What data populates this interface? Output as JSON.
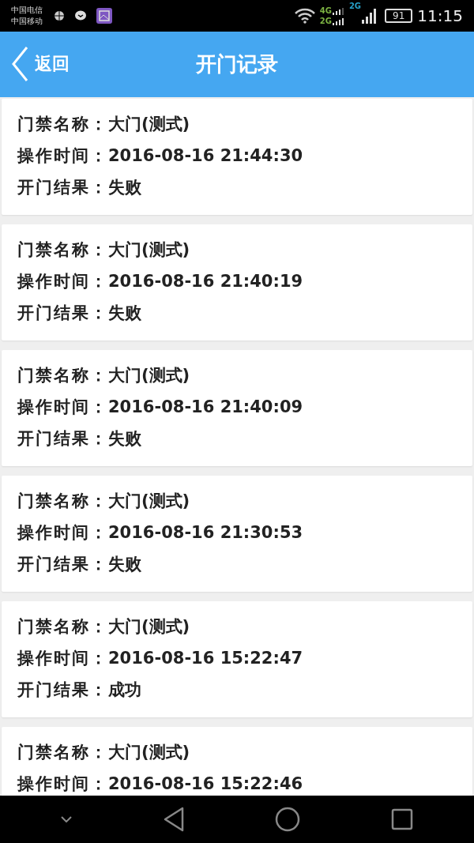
{
  "status_bar": {
    "carriers": [
      "中国电信",
      "中国移动"
    ],
    "network_1": "4G",
    "network_2": "2G",
    "network_3": "2G",
    "battery": "91",
    "time": "11:15"
  },
  "header": {
    "back": "返回",
    "title": "开门记录"
  },
  "records": [
    {
      "fields": [
        {
          "label": "门禁名称：",
          "value": "大门(测式)"
        },
        {
          "label": "操作时间：",
          "value": "2016-08-16 21:44:30"
        },
        {
          "label": "开门结果：",
          "value": "失败"
        }
      ]
    },
    {
      "fields": [
        {
          "label": "门禁名称：",
          "value": "大门(测式)"
        },
        {
          "label": "操作时间：",
          "value": "2016-08-16 21:40:19"
        },
        {
          "label": "开门结果：",
          "value": "失败"
        }
      ]
    },
    {
      "fields": [
        {
          "label": "门禁名称：",
          "value": "大门(测式)"
        },
        {
          "label": "操作时间：",
          "value": "2016-08-16 21:40:09"
        },
        {
          "label": "开门结果：",
          "value": "失败"
        }
      ]
    },
    {
      "fields": [
        {
          "label": "门禁名称：",
          "value": "大门(测式)"
        },
        {
          "label": "操作时间：",
          "value": "2016-08-16 21:30:53"
        },
        {
          "label": "开门结果：",
          "value": "失败"
        }
      ]
    },
    {
      "fields": [
        {
          "label": "门禁名称：",
          "value": "大门(测式)"
        },
        {
          "label": "操作时间：",
          "value": "2016-08-16 15:22:47"
        },
        {
          "label": "开门结果：",
          "value": "成功"
        }
      ]
    },
    {
      "fields": [
        {
          "label": "门禁名称：",
          "value": "大门(测式)"
        },
        {
          "label": "操作时间：",
          "value": "2016-08-16 15:22:46"
        }
      ]
    }
  ]
}
